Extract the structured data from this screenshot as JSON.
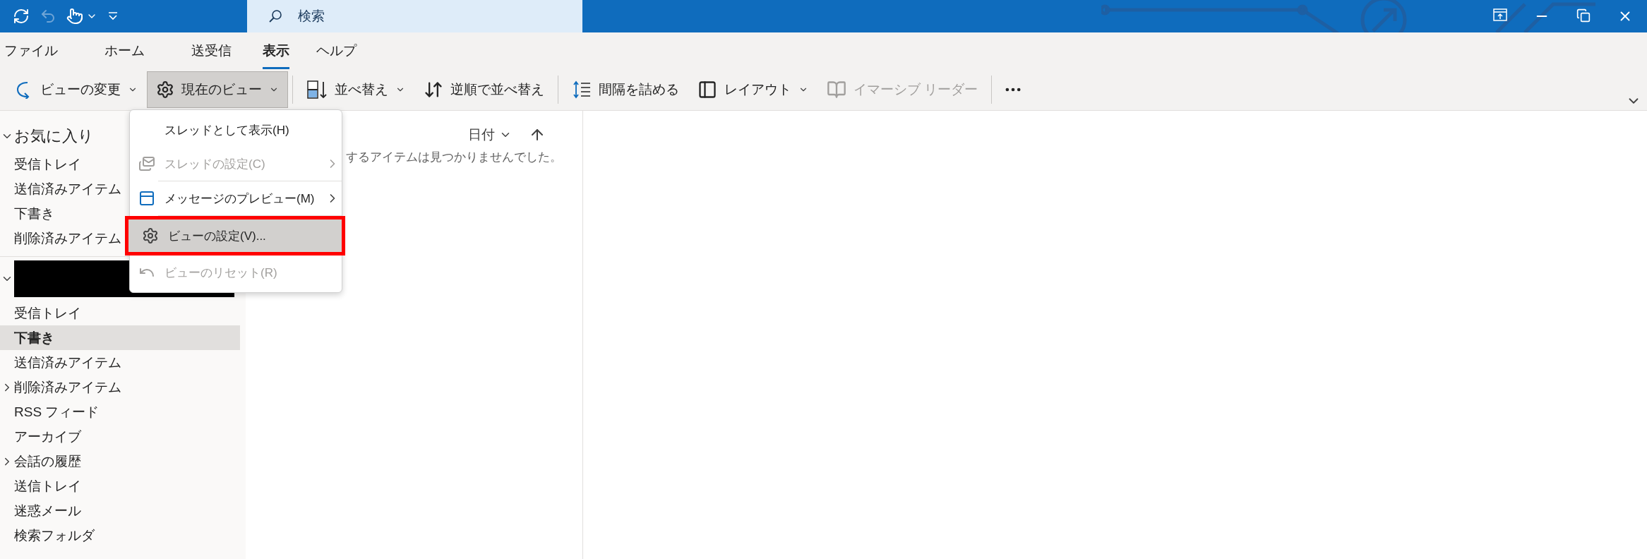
{
  "quick_access": [
    {
      "kind": "sync",
      "disabled": false
    },
    {
      "kind": "undo",
      "disabled": true
    },
    {
      "kind": "touch",
      "disabled": false
    },
    {
      "kind": "customize",
      "disabled": false
    }
  ],
  "search": {
    "placeholder": "検索"
  },
  "menu_tabs": [
    {
      "label": "ファイル",
      "selected": false
    },
    {
      "label": "ホーム",
      "selected": false
    },
    {
      "label": "送受信",
      "selected": false
    },
    {
      "label": "表示",
      "selected": true
    },
    {
      "label": "ヘルプ",
      "selected": false
    }
  ],
  "ribbon": [
    {
      "kind": "button",
      "label": "ビューの変更",
      "dropdown": true,
      "pressed": false,
      "disabled": false
    },
    {
      "kind": "button",
      "label": "現在のビュー",
      "dropdown": true,
      "pressed": true,
      "disabled": false
    },
    {
      "kind": "separator"
    },
    {
      "kind": "button",
      "label": "並べ替え",
      "dropdown": true,
      "pressed": false,
      "disabled": false
    },
    {
      "kind": "button",
      "label": "逆順で並べ替え",
      "dropdown": false,
      "pressed": false,
      "disabled": false
    },
    {
      "kind": "separator"
    },
    {
      "kind": "button",
      "label": "間隔を詰める",
      "dropdown": false,
      "pressed": false,
      "disabled": false
    },
    {
      "kind": "button",
      "label": "レイアウト",
      "dropdown": true,
      "pressed": false,
      "disabled": false
    },
    {
      "kind": "button",
      "label": "イマーシブ リーダー",
      "dropdown": false,
      "pressed": false,
      "disabled": true
    },
    {
      "kind": "separator"
    },
    {
      "kind": "more"
    }
  ],
  "dropdown_menu": [
    {
      "label": "スレッドとして表示(H)",
      "disabled": false,
      "submenu": false,
      "selected": false,
      "outlined": false
    },
    {
      "label": "スレッドの設定(C)",
      "disabled": true,
      "submenu": true,
      "selected": false,
      "outlined": false
    },
    {
      "label": "メッセージのプレビュー(M)",
      "disabled": false,
      "submenu": true,
      "selected": false,
      "outlined": false
    },
    {
      "label": "ビューの設定(V)...",
      "disabled": false,
      "submenu": false,
      "selected": true,
      "outlined": true
    },
    {
      "label": "ビューのリセット(R)",
      "disabled": true,
      "submenu": false,
      "selected": false,
      "outlined": false
    }
  ],
  "sidebar": [
    {
      "title": "お気に入り",
      "redacted": false,
      "expanded": true,
      "items": [
        {
          "label": "受信トレイ",
          "kind": "folder",
          "selected": false
        },
        {
          "label": "送信済みアイテム",
          "kind": "folder",
          "selected": false
        },
        {
          "label": "下書き",
          "kind": "folder",
          "selected": false
        },
        {
          "label": "削除済みアイテム",
          "kind": "folder",
          "selected": false
        }
      ]
    },
    {
      "redacted": true,
      "expanded": true,
      "items": [
        {
          "label": "受信トレイ",
          "kind": "folder",
          "selected": false
        },
        {
          "label": "下書き",
          "kind": "folder",
          "selected": true
        },
        {
          "label": "送信済みアイテム",
          "kind": "folder",
          "selected": false
        },
        {
          "label": "削除済みアイテム",
          "kind": "collapsed",
          "selected": false
        },
        {
          "label": "RSS フィード",
          "kind": "folder",
          "selected": false
        },
        {
          "label": "アーカイブ",
          "kind": "folder",
          "selected": false
        },
        {
          "label": "会話の履歴",
          "kind": "collapsed",
          "selected": false
        },
        {
          "label": "送信トレイ",
          "kind": "folder",
          "selected": false
        },
        {
          "label": "迷惑メール",
          "kind": "folder",
          "selected": false
        },
        {
          "label": "検索フォルダ",
          "kind": "folder",
          "selected": false
        }
      ]
    }
  ],
  "message_list": {
    "sort_label": "日付",
    "empty_text": "するアイテムは見つかりませんでした。"
  }
}
